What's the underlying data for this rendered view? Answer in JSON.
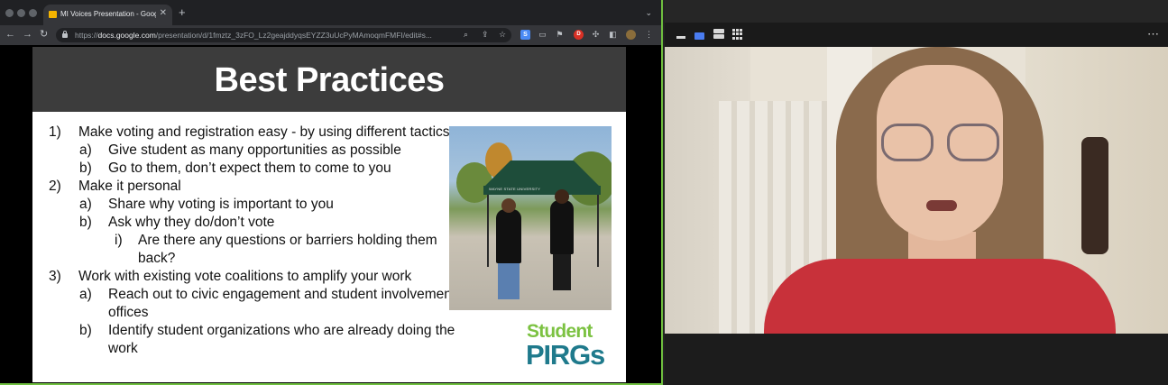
{
  "browser": {
    "tab": {
      "title": "MI Voices Presentation - Goog",
      "close_glyph": "✕"
    },
    "newtab_glyph": "+",
    "tabstrip_menu_glyph": "⌄",
    "toolbar": {
      "back_glyph": "←",
      "forward_glyph": "→",
      "reload_glyph": "↻",
      "url_scheme": "https://",
      "url_host": "docs.google.com",
      "url_path": "/presentation/d/1fmztz_3zFO_Lz2geajddyqsEYZZ3uUcPyMAmoqmFMFI/edit#s...",
      "ext_s_label": "S",
      "ext_d_label": "D",
      "menu_glyph": "⋮"
    }
  },
  "slide": {
    "title": "Best Practices",
    "photo_banner": "WAYNE STATE UNIVERSITY",
    "bullets": [
      {
        "num": "1)",
        "text": "Make voting and registration easy - by using different tactics",
        "level": 1
      },
      {
        "num": "a)",
        "text": "Give student as many opportunities as possible",
        "level": 2
      },
      {
        "num": "b)",
        "text": "Go to them, don’t expect them to come to you",
        "level": 2
      },
      {
        "num": "2)",
        "text": "Make it personal",
        "level": 1
      },
      {
        "num": "a)",
        "text": "Share why voting is important to you",
        "level": 2
      },
      {
        "num": "b)",
        "text": "Ask why they do/don’t vote",
        "level": 2
      },
      {
        "num": "i)",
        "text": "Are there any questions or barriers holding them back?",
        "level": 3
      },
      {
        "num": "3)",
        "text": "Work with existing vote coalitions to amplify your work",
        "level": 1
      },
      {
        "num": "a)",
        "text": "Reach out to civic engagement and student involvement offices",
        "level": 2
      },
      {
        "num": "b)",
        "text": "Identify student organizations who are already doing the work",
        "level": 2
      }
    ],
    "logo": {
      "line1": "Student",
      "line2": "PIRGs"
    }
  },
  "video_bar": {
    "more_glyph": "⋯"
  },
  "colors": {
    "accent_border": "#6fbf3f",
    "slide_header": "#3c3c3c",
    "logo_green": "#7cc242",
    "logo_teal": "#1f7a8c"
  }
}
